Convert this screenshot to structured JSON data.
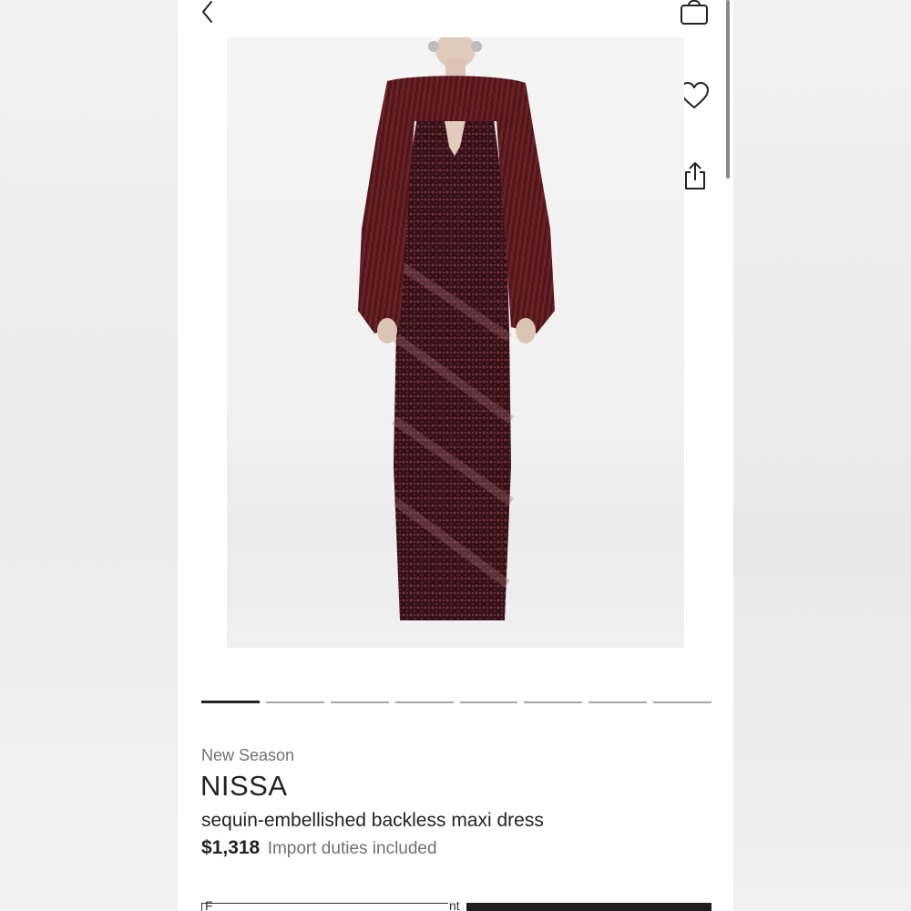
{
  "product": {
    "label": "New Season",
    "brand": "NISSA",
    "name": "sequin-embellished backless maxi dress",
    "price": "$1,318",
    "price_note": "Import duties included"
  },
  "gallery": {
    "total_images": 8,
    "current_index": 1,
    "garment_color": "#3a1218",
    "fur_color": "#5c1a1f"
  },
  "icons": {
    "back": "chevron-left-icon",
    "bag": "shopping-bag-icon",
    "wishlist": "heart-icon",
    "share": "share-icon"
  },
  "cut_off": {
    "left_text": "F",
    "mid_text": "nt"
  }
}
